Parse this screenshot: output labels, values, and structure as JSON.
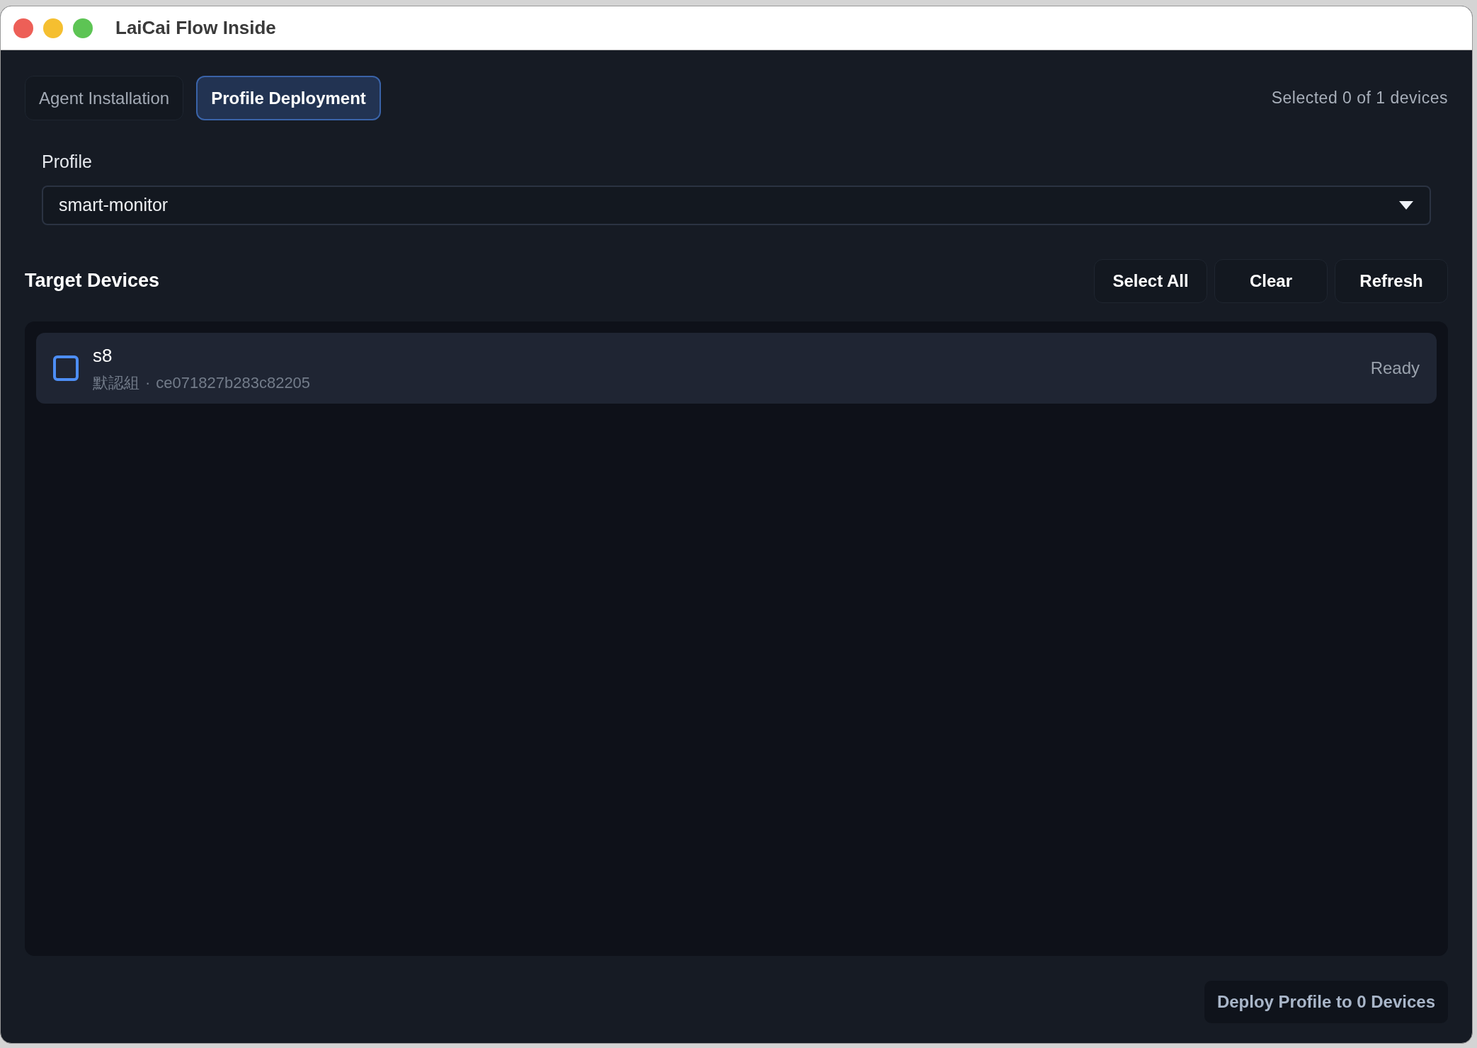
{
  "window": {
    "title": "LaiCai Flow Inside"
  },
  "tabs": [
    {
      "label": "Agent Installation",
      "selected": false
    },
    {
      "label": "Profile Deployment",
      "selected": true
    }
  ],
  "selection_summary": "Selected 0 of 1 devices",
  "profile": {
    "label": "Profile",
    "value": "smart-monitor"
  },
  "target_devices": {
    "title": "Target Devices",
    "buttons": [
      "Select All",
      "Clear",
      "Refresh"
    ],
    "devices": [
      {
        "name": "s8",
        "group": "默認組",
        "separator": "·",
        "serial": "ce071827b283c82205",
        "status": "Ready",
        "checked": false
      }
    ]
  },
  "deploy_button": {
    "label": "Deploy Profile to 0 Devices",
    "disabled": true
  }
}
